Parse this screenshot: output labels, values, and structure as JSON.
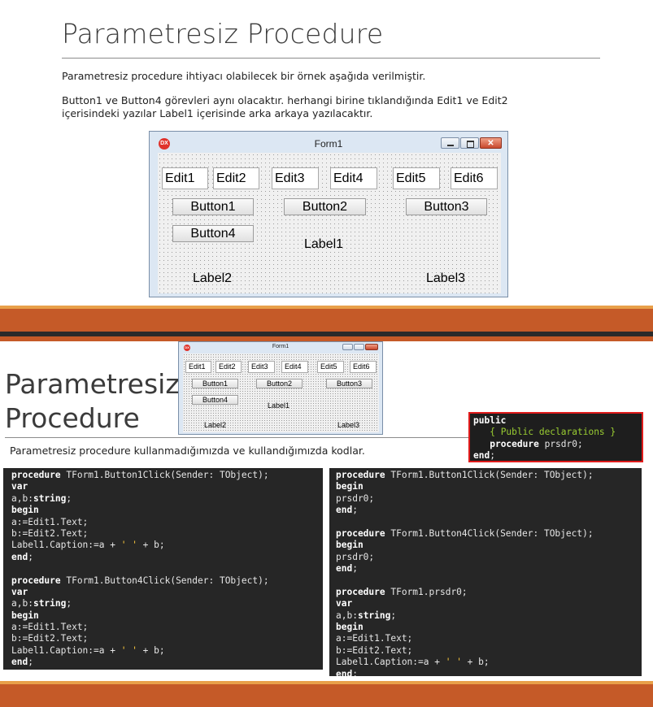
{
  "slide1": {
    "title": "Parametresiz Procedure",
    "para1": "Parametresiz procedure ihtiyacı olabilecek bir örnek aşağıda verilmiştir.",
    "para2_line1": "Button1 ve Button4 görevleri aynı olacaktır. herhangi birine tıklandığında Edit1 ve Edit2",
    "para2_line2": "içerisindeki yazılar Label1 içerisinde arka arkaya yazılacaktır."
  },
  "form": {
    "window_title": "Form1",
    "dx_icon": "DX",
    "edits": [
      "Edit1",
      "Edit2",
      "Edit3",
      "Edit4",
      "Edit5",
      "Edit6"
    ],
    "buttons": [
      "Button1",
      "Button2",
      "Button3",
      "Button4"
    ],
    "labels": [
      "Label1",
      "Label2",
      "Label3"
    ]
  },
  "slide2": {
    "title_line1": "Parametresiz",
    "title_line2": "Procedure",
    "caption": "Parametresiz procedure kullanmadığımızda ve kullandığımızda kodlar."
  },
  "public_box": {
    "lines": [
      {
        "kw": "public",
        "rest": ""
      },
      {
        "indent": "   ",
        "comment": "{ Public declarations }"
      },
      {
        "indent": "   ",
        "kw": "procedure",
        "rest": " prsdr0;"
      },
      {
        "kw": "end",
        "rest": ";"
      }
    ]
  },
  "code_left": [
    [
      {
        "k": "kw",
        "t": "procedure"
      },
      {
        "k": "",
        "t": " TForm1.Button1Click(Sender: TObject);"
      }
    ],
    [
      {
        "k": "kw",
        "t": "var"
      }
    ],
    [
      {
        "k": "",
        "t": "a,b:"
      },
      {
        "k": "kw",
        "t": "string"
      },
      {
        "k": "",
        "t": ";"
      }
    ],
    [
      {
        "k": "kw",
        "t": "begin"
      }
    ],
    [
      {
        "k": "",
        "t": "a:=Edit1.Text;"
      }
    ],
    [
      {
        "k": "",
        "t": "b:=Edit2.Text;"
      }
    ],
    [
      {
        "k": "",
        "t": "Label1.Caption:=a + "
      },
      {
        "k": "str",
        "t": "' '"
      },
      {
        "k": "",
        "t": " + b;"
      }
    ],
    [
      {
        "k": "kw",
        "t": "end"
      },
      {
        "k": "",
        "t": ";"
      }
    ],
    [],
    [
      {
        "k": "kw",
        "t": "procedure"
      },
      {
        "k": "",
        "t": " TForm1.Button4Click(Sender: TObject);"
      }
    ],
    [
      {
        "k": "kw",
        "t": "var"
      }
    ],
    [
      {
        "k": "",
        "t": "a,b:"
      },
      {
        "k": "kw",
        "t": "string"
      },
      {
        "k": "",
        "t": ";"
      }
    ],
    [
      {
        "k": "kw",
        "t": "begin"
      }
    ],
    [
      {
        "k": "",
        "t": "a:=Edit1.Text;"
      }
    ],
    [
      {
        "k": "",
        "t": "b:=Edit2.Text;"
      }
    ],
    [
      {
        "k": "",
        "t": "Label1.Caption:=a + "
      },
      {
        "k": "str",
        "t": "' '"
      },
      {
        "k": "",
        "t": " + b;"
      }
    ],
    [
      {
        "k": "kw",
        "t": "end"
      },
      {
        "k": "",
        "t": ";"
      }
    ]
  ],
  "code_right": [
    [
      {
        "k": "kw",
        "t": "procedure"
      },
      {
        "k": "",
        "t": " TForm1.Button1Click(Sender: TObject);"
      }
    ],
    [
      {
        "k": "kw",
        "t": "begin"
      }
    ],
    [
      {
        "k": "",
        "t": "prsdr0;"
      }
    ],
    [
      {
        "k": "kw",
        "t": "end"
      },
      {
        "k": "",
        "t": ";"
      }
    ],
    [],
    [
      {
        "k": "kw",
        "t": "procedure"
      },
      {
        "k": "",
        "t": " TForm1.Button4Click(Sender: TObject);"
      }
    ],
    [
      {
        "k": "kw",
        "t": "begin"
      }
    ],
    [
      {
        "k": "",
        "t": "prsdr0;"
      }
    ],
    [
      {
        "k": "kw",
        "t": "end"
      },
      {
        "k": "",
        "t": ";"
      }
    ],
    [],
    [
      {
        "k": "kw",
        "t": "procedure"
      },
      {
        "k": "",
        "t": " TForm1.prsdr0;"
      }
    ],
    [
      {
        "k": "kw",
        "t": "var"
      }
    ],
    [
      {
        "k": "",
        "t": "a,b:"
      },
      {
        "k": "kw",
        "t": "string"
      },
      {
        "k": "",
        "t": ";"
      }
    ],
    [
      {
        "k": "kw",
        "t": "begin"
      }
    ],
    [
      {
        "k": "",
        "t": "a:=Edit1.Text;"
      }
    ],
    [
      {
        "k": "",
        "t": "b:=Edit2.Text;"
      }
    ],
    [
      {
        "k": "",
        "t": "Label1.Caption:=a + "
      },
      {
        "k": "str",
        "t": "' '"
      },
      {
        "k": "",
        "t": " + b;"
      }
    ],
    [
      {
        "k": "kw",
        "t": "end"
      },
      {
        "k": "",
        "t": ";"
      }
    ]
  ],
  "colors": {
    "accent_bar": "#c55a28",
    "accent_thin": "#e8a04a",
    "code_bg": "#262626",
    "highlight_border": "#e01b1b"
  }
}
